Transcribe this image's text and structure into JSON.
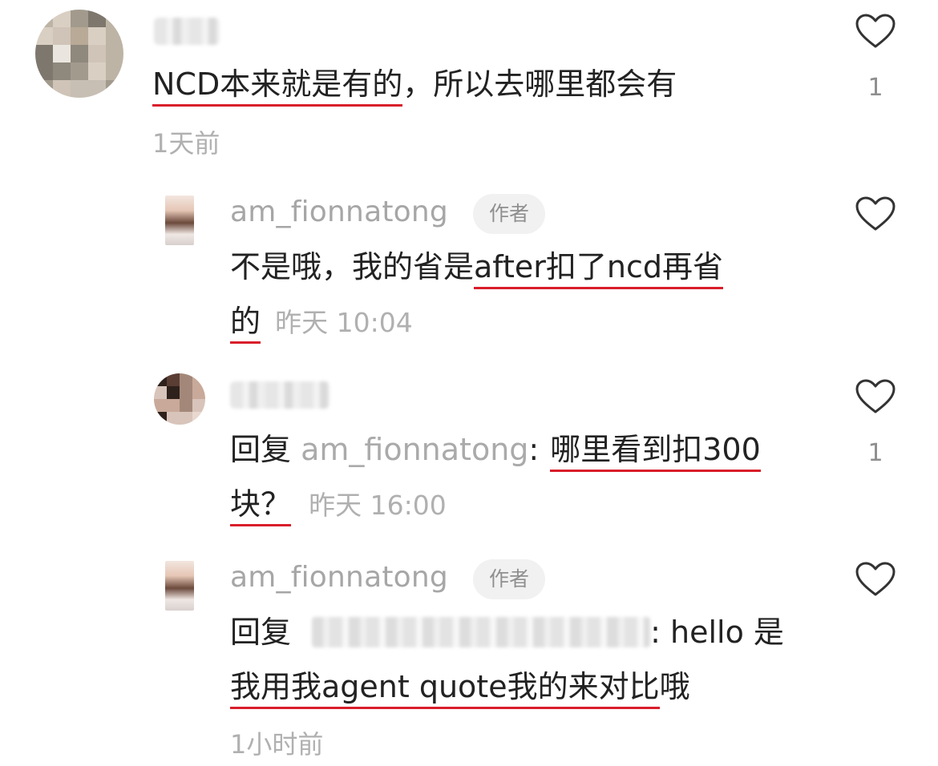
{
  "comment": {
    "text_underlined": "NCD本来就是有的",
    "text_rest": "，所以去哪里都会有",
    "time": "1天前",
    "likes": "1"
  },
  "reply1": {
    "username": "am_fionnatong",
    "author_tag": "作者",
    "text_plain": "不是哦，我的省是",
    "text_underlined_1": "after扣了ncd再省",
    "text_underlined_2": "的",
    "time": "昨天 10:04"
  },
  "reply2": {
    "reply_prefix": "回复",
    "reply_target": "am_fionnatong",
    "colon": ":",
    "text_underlined_1": "哪里看到扣300",
    "text_underlined_2": "块？",
    "time": "昨天 16:00",
    "likes": "1"
  },
  "reply3": {
    "username": "am_fionnatong",
    "author_tag": "作者",
    "reply_prefix": "回复",
    "text_after_target": ": hello 是",
    "text_underlined": "我用我agent quote我的来对比",
    "text_last": "哦",
    "time": "1小时前"
  },
  "colors": {
    "accent_underline": "#d91e2b",
    "muted_text": "#aaaaaa",
    "body_text": "#222222"
  },
  "icons": {
    "like": "heart-outline-icon"
  }
}
